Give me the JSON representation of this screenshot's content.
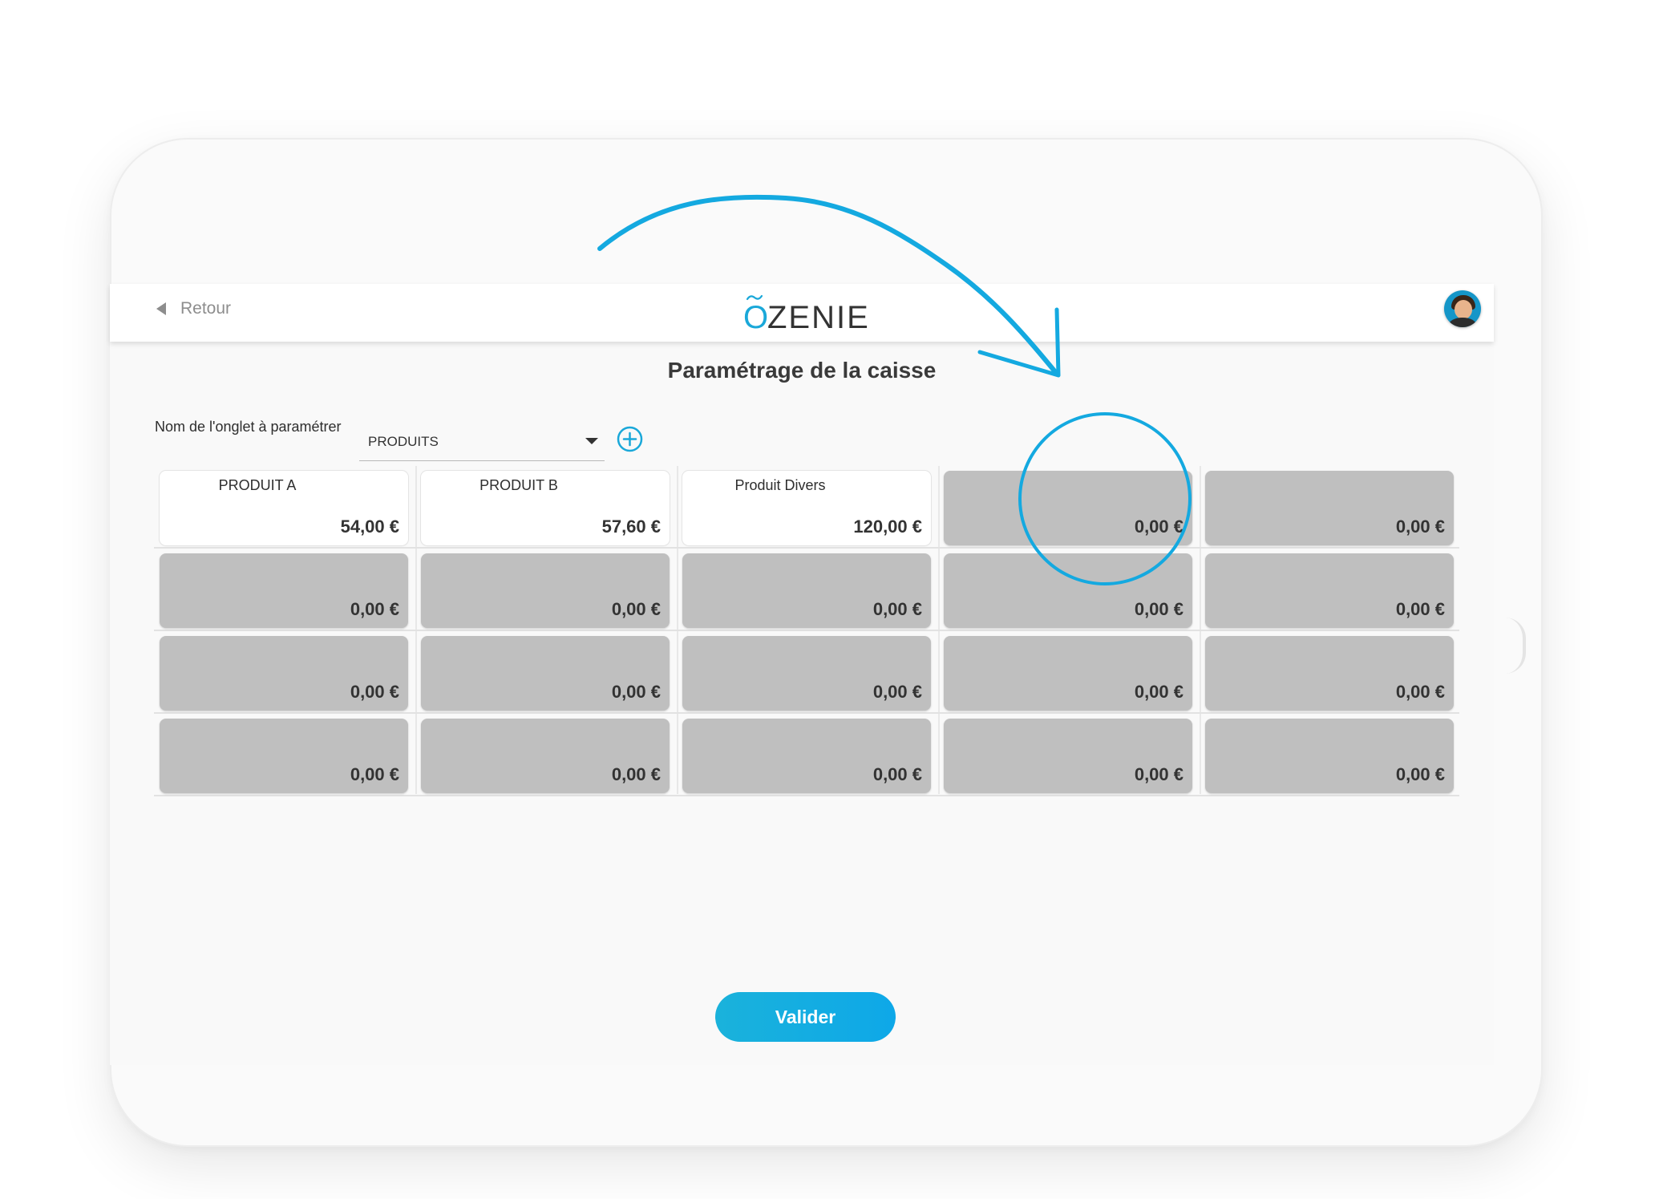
{
  "header": {
    "back_label": "Retour",
    "logo": {
      "first_letter": "O",
      "rest": "ZENIE"
    }
  },
  "page": {
    "title": "Paramétrage de la caisse"
  },
  "tab_config": {
    "label": "Nom de l'onglet à paramétrer",
    "selected_tab": "PRODUITS"
  },
  "products": [
    {
      "name": "PRODUIT A",
      "price": "54,00 €"
    },
    {
      "name": "PRODUIT B",
      "price": "57,60 €"
    },
    {
      "name": "Produit Divers",
      "price": "120,00 €"
    },
    {
      "name": "",
      "price": "0,00 €"
    },
    {
      "name": "",
      "price": "0,00 €"
    },
    {
      "name": "",
      "price": "0,00 €"
    },
    {
      "name": "",
      "price": "0,00 €"
    },
    {
      "name": "",
      "price": "0,00 €"
    },
    {
      "name": "",
      "price": "0,00 €"
    },
    {
      "name": "",
      "price": "0,00 €"
    },
    {
      "name": "",
      "price": "0,00 €"
    },
    {
      "name": "",
      "price": "0,00 €"
    },
    {
      "name": "",
      "price": "0,00 €"
    },
    {
      "name": "",
      "price": "0,00 €"
    },
    {
      "name": "",
      "price": "0,00 €"
    },
    {
      "name": "",
      "price": "0,00 €"
    },
    {
      "name": "",
      "price": "0,00 €"
    },
    {
      "name": "",
      "price": "0,00 €"
    },
    {
      "name": "",
      "price": "0,00 €"
    },
    {
      "name": "",
      "price": "0,00 €"
    }
  ],
  "actions": {
    "validate_label": "Valider"
  },
  "colors": {
    "accent": "#1aa8d9",
    "empty_cell": "#bfbfbf",
    "annotation": "#14a9e0"
  },
  "icons": {
    "back": "triangle-left-icon",
    "add": "plus-circle-icon",
    "dropdown": "caret-down-icon",
    "avatar": "user-avatar"
  }
}
